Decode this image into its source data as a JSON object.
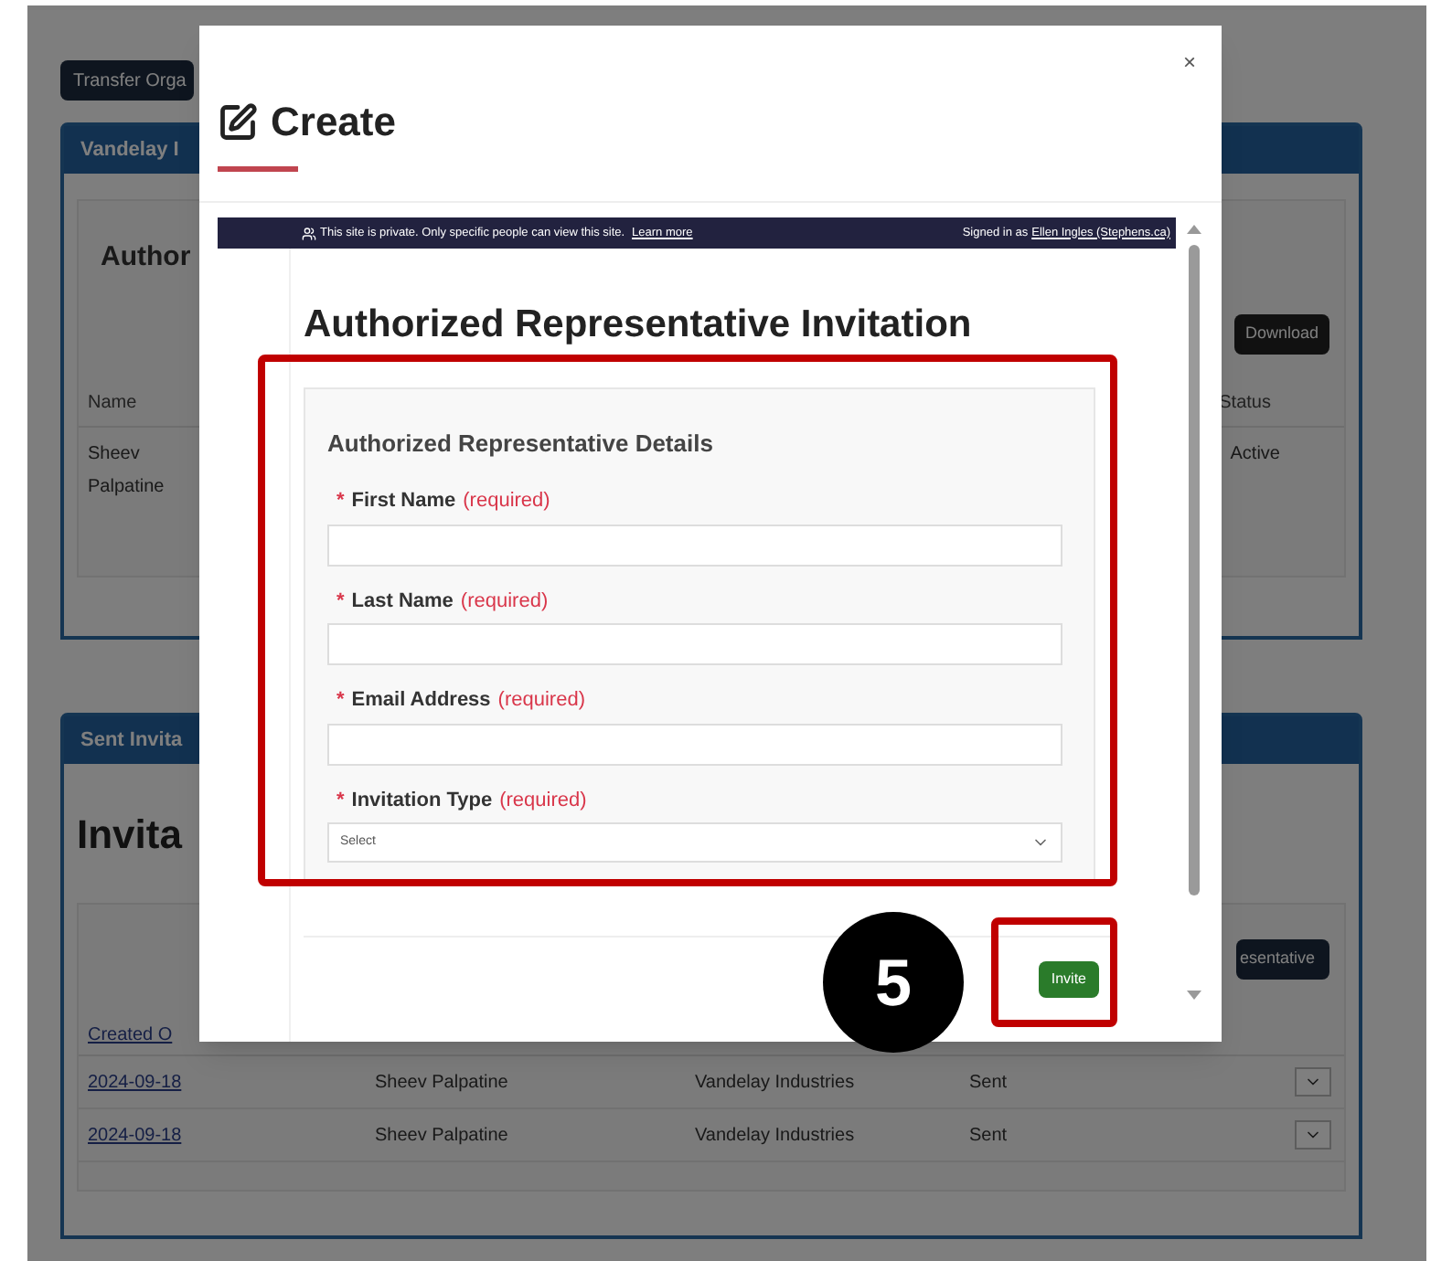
{
  "page": {
    "transfer_button": "Transfer Orga",
    "org_panel": {
      "header": "Vandelay I",
      "heading": "Author",
      "download_button": "Download",
      "columns": [
        "Name",
        "Status"
      ],
      "rows": [
        {
          "name": "Sheev Palpatine",
          "status": "Active"
        }
      ]
    },
    "invitations_panel": {
      "header": "Sent Invita",
      "heading": "Invita",
      "add_button": "esentative",
      "columns": [
        "Created O"
      ],
      "rows": [
        {
          "created": "2024-09-18",
          "name": "Sheev Palpatine",
          "organization": "Vandelay Industries",
          "status": "Sent"
        },
        {
          "created": "2024-09-18",
          "name": "Sheev Palpatine",
          "organization": "Vandelay Industries",
          "status": "Sent"
        }
      ]
    }
  },
  "dialog": {
    "title": "Create",
    "close": "×",
    "banner": {
      "message": "This site is private. Only specific people can view this site.",
      "link": "Learn more",
      "signed_in": "Signed in as",
      "user": "Ellen Ingles (Stephens.ca)"
    },
    "heading": "Authorized Representative Invitation",
    "section": "Authorized Representative Details",
    "fields": [
      {
        "kind": "text",
        "asterisk": "*",
        "label": "First Name",
        "note": "(required)"
      },
      {
        "kind": "text",
        "asterisk": "*",
        "label": "Last Name",
        "note": "(required)"
      },
      {
        "kind": "text",
        "asterisk": "*",
        "label": "Email Address",
        "note": "(required)"
      },
      {
        "kind": "select",
        "asterisk": "*",
        "label": "Invitation Type",
        "note": "(required)",
        "value": "Select"
      }
    ],
    "submit": "Invite"
  },
  "annotation": {
    "step": "5"
  }
}
